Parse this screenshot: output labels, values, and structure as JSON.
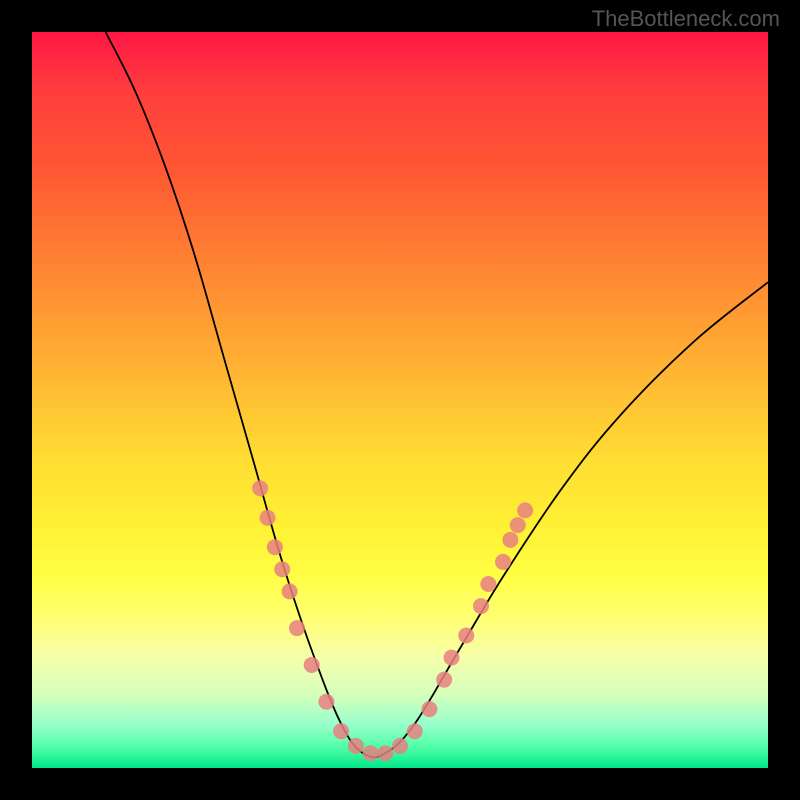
{
  "watermark": "TheBottleneck.com",
  "chart_data": {
    "type": "line",
    "title": "",
    "xlabel": "",
    "ylabel": "",
    "xlim": [
      0,
      100
    ],
    "ylim": [
      0,
      100
    ],
    "curve": {
      "description": "V-shaped bottleneck curve with minimum near x≈45",
      "points": [
        {
          "x": 10,
          "y": 100
        },
        {
          "x": 14,
          "y": 92
        },
        {
          "x": 18,
          "y": 82
        },
        {
          "x": 22,
          "y": 70
        },
        {
          "x": 26,
          "y": 56
        },
        {
          "x": 30,
          "y": 42
        },
        {
          "x": 34,
          "y": 28
        },
        {
          "x": 38,
          "y": 16
        },
        {
          "x": 42,
          "y": 6
        },
        {
          "x": 45,
          "y": 2
        },
        {
          "x": 48,
          "y": 2
        },
        {
          "x": 52,
          "y": 6
        },
        {
          "x": 58,
          "y": 16
        },
        {
          "x": 64,
          "y": 26
        },
        {
          "x": 72,
          "y": 38
        },
        {
          "x": 80,
          "y": 48
        },
        {
          "x": 90,
          "y": 58
        },
        {
          "x": 100,
          "y": 66
        }
      ]
    },
    "markers": {
      "color": "#e88080",
      "radius": 8,
      "points": [
        {
          "x": 31,
          "y": 38
        },
        {
          "x": 32,
          "y": 34
        },
        {
          "x": 33,
          "y": 30
        },
        {
          "x": 34,
          "y": 27
        },
        {
          "x": 35,
          "y": 24
        },
        {
          "x": 36,
          "y": 19
        },
        {
          "x": 38,
          "y": 14
        },
        {
          "x": 40,
          "y": 9
        },
        {
          "x": 42,
          "y": 5
        },
        {
          "x": 44,
          "y": 3
        },
        {
          "x": 46,
          "y": 2
        },
        {
          "x": 48,
          "y": 2
        },
        {
          "x": 50,
          "y": 3
        },
        {
          "x": 52,
          "y": 5
        },
        {
          "x": 54,
          "y": 8
        },
        {
          "x": 56,
          "y": 12
        },
        {
          "x": 57,
          "y": 15
        },
        {
          "x": 59,
          "y": 18
        },
        {
          "x": 61,
          "y": 22
        },
        {
          "x": 62,
          "y": 25
        },
        {
          "x": 64,
          "y": 28
        },
        {
          "x": 65,
          "y": 31
        },
        {
          "x": 66,
          "y": 33
        },
        {
          "x": 67,
          "y": 35
        }
      ]
    },
    "gradient_stops": [
      {
        "pos": 0,
        "color": "#ff1744"
      },
      {
        "pos": 50,
        "color": "#ffdd33"
      },
      {
        "pos": 100,
        "color": "#00e888"
      }
    ]
  }
}
